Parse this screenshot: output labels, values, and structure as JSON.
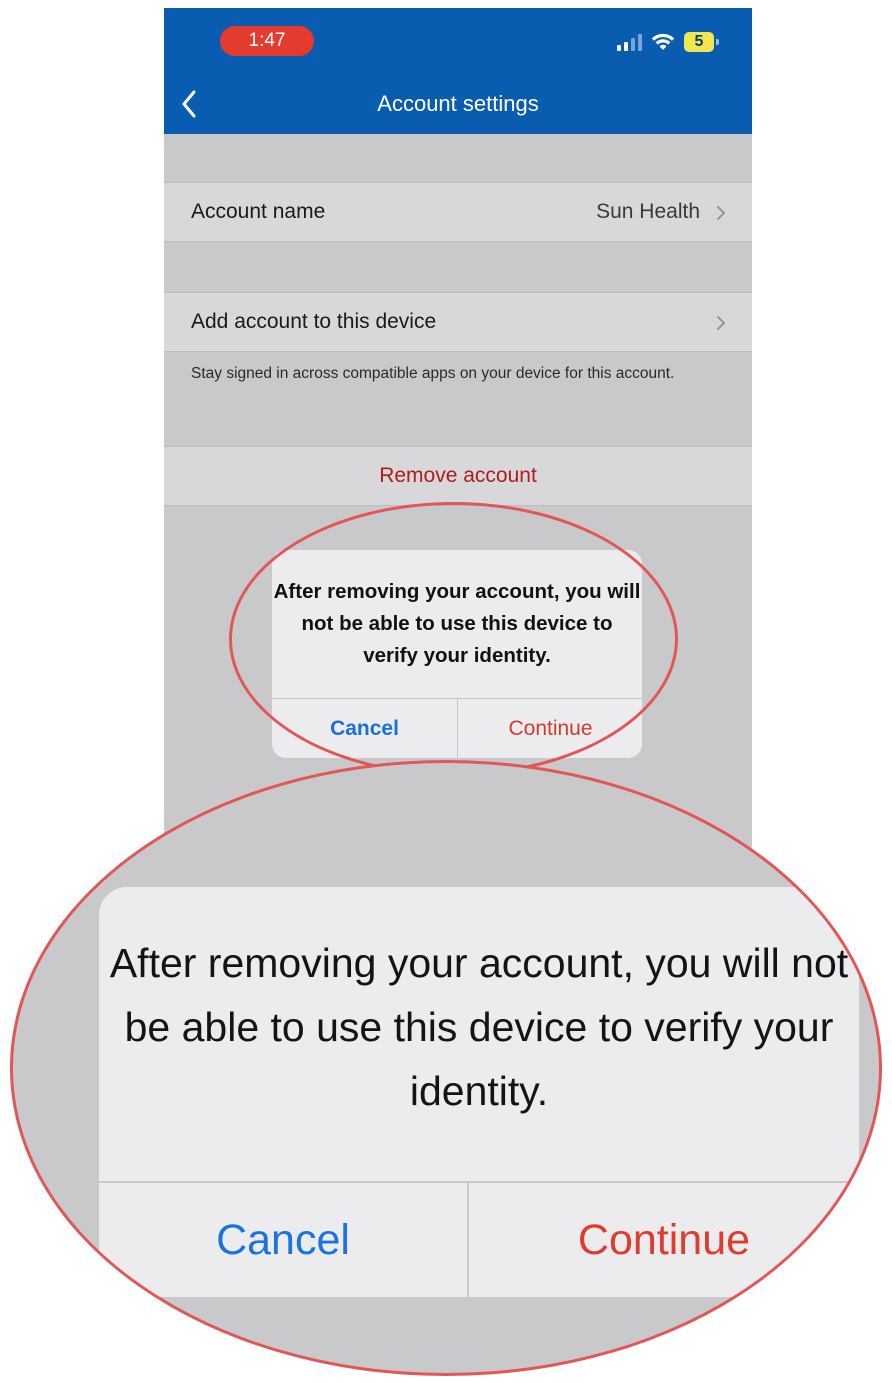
{
  "status_bar": {
    "time": "1:47",
    "battery": "5",
    "signal_icon": "cellular-signal-icon",
    "wifi_icon": "wifi-icon"
  },
  "header": {
    "title": "Account settings",
    "back_icon": "chevron-left-icon",
    "background_color": "#0a5cb0"
  },
  "settings": {
    "account_name": {
      "label": "Account name",
      "value": "Sun Health"
    },
    "add_account": {
      "label": "Add account to this device",
      "description": "Stay signed in across compatible apps on your device for this account."
    },
    "remove_account": {
      "label": "Remove account",
      "color": "#b01d1d"
    }
  },
  "dialog": {
    "message": "After removing your account, you will not be able to use this device to verify your identity.",
    "cancel_label": "Cancel",
    "continue_label": "Continue",
    "cancel_color": "#1a6fd8",
    "continue_color": "#d53b2c"
  },
  "callout": {
    "ring_color": "#e25658",
    "message": "After removing your account, you will not be able to use this device to verify your identity.",
    "cancel_label": "Cancel",
    "continue_label": "Continue"
  }
}
